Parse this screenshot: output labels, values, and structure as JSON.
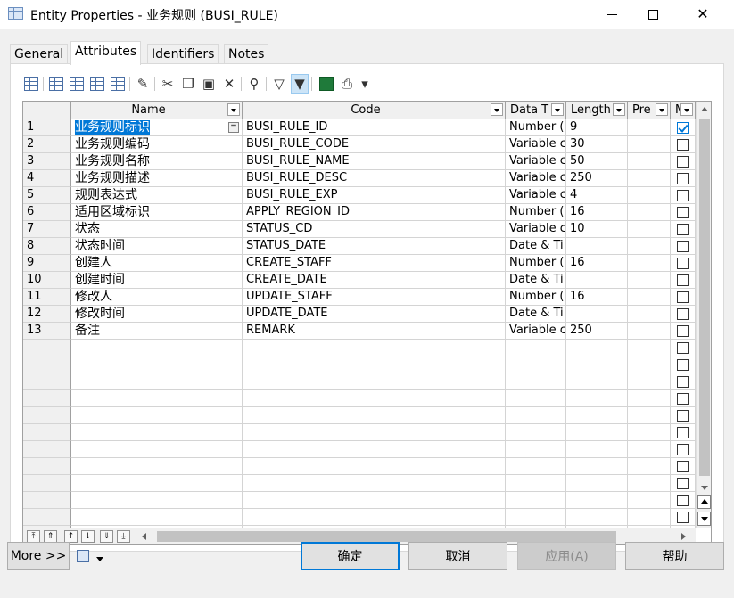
{
  "window": {
    "title": "Entity Properties - 业务规则 (BUSI_RULE)"
  },
  "tabs": [
    "General",
    "Attributes",
    "Identifiers",
    "Notes"
  ],
  "active_tab": "Attributes",
  "columns": [
    {
      "key": "name",
      "label": "Name"
    },
    {
      "key": "code",
      "label": "Code"
    },
    {
      "key": "datatype",
      "label": "Data T"
    },
    {
      "key": "length",
      "label": "Length"
    },
    {
      "key": "precision",
      "label": "Pre"
    },
    {
      "key": "mandatory",
      "label": "M"
    }
  ],
  "rows": [
    {
      "num": "1",
      "name": "业务规则标识",
      "code": "BUSI_RULE_ID",
      "datatype": "Number (9",
      "length": "9",
      "mandatory": true
    },
    {
      "num": "2",
      "name": "业务规则编码",
      "code": "BUSI_RULE_CODE",
      "datatype": "Variable c",
      "length": "30",
      "mandatory": false
    },
    {
      "num": "3",
      "name": "业务规则名称",
      "code": "BUSI_RULE_NAME",
      "datatype": "Variable c",
      "length": "50",
      "mandatory": false
    },
    {
      "num": "4",
      "name": "业务规则描述",
      "code": "BUSI_RULE_DESC",
      "datatype": "Variable c",
      "length": "250",
      "mandatory": false
    },
    {
      "num": "5",
      "name": "规则表达式",
      "code": "BUSI_RULE_EXP",
      "datatype": "Variable c",
      "length": "4",
      "mandatory": false
    },
    {
      "num": "6",
      "name": "适用区域标识",
      "code": "APPLY_REGION_ID",
      "datatype": "Number (1",
      "length": "16",
      "mandatory": false
    },
    {
      "num": "7",
      "name": "状态",
      "code": "STATUS_CD",
      "datatype": "Variable c",
      "length": "10",
      "mandatory": false
    },
    {
      "num": "8",
      "name": "状态时间",
      "code": "STATUS_DATE",
      "datatype": "Date & Ti",
      "length": "",
      "mandatory": false
    },
    {
      "num": "9",
      "name": "创建人",
      "code": "CREATE_STAFF",
      "datatype": "Number (1",
      "length": "16",
      "mandatory": false
    },
    {
      "num": "10",
      "name": "创建时间",
      "code": "CREATE_DATE",
      "datatype": "Date & Ti",
      "length": "",
      "mandatory": false
    },
    {
      "num": "11",
      "name": "修改人",
      "code": "UPDATE_STAFF",
      "datatype": "Number (1",
      "length": "16",
      "mandatory": false
    },
    {
      "num": "12",
      "name": "修改时间",
      "code": "UPDATE_DATE",
      "datatype": "Date & Ti",
      "length": "",
      "mandatory": false
    },
    {
      "num": "13",
      "name": "备注",
      "code": "REMARK",
      "datatype": "Variable c",
      "length": "250",
      "mandatory": false
    }
  ],
  "empty_rows": 12,
  "toolbar_icons": [
    "properties-icon",
    "insert-row-icon",
    "add-row-icon",
    "add-attributes-icon",
    "reuse-attributes-icon",
    "find-icon-sep",
    "sep",
    "cut-icon",
    "copy-icon",
    "paste-icon",
    "delete-icon",
    "sep",
    "find-icon",
    "sep",
    "filter-icon",
    "filter-active-icon",
    "sep",
    "excel-icon",
    "print-icon",
    "dropdown-arrow-icon"
  ],
  "buttons": {
    "more": "More >>",
    "ok": "确定",
    "cancel": "取消",
    "apply": "应用(A)",
    "help": "帮助"
  },
  "colors": {
    "selection": "#0078d7",
    "accent": "#0078d7"
  }
}
